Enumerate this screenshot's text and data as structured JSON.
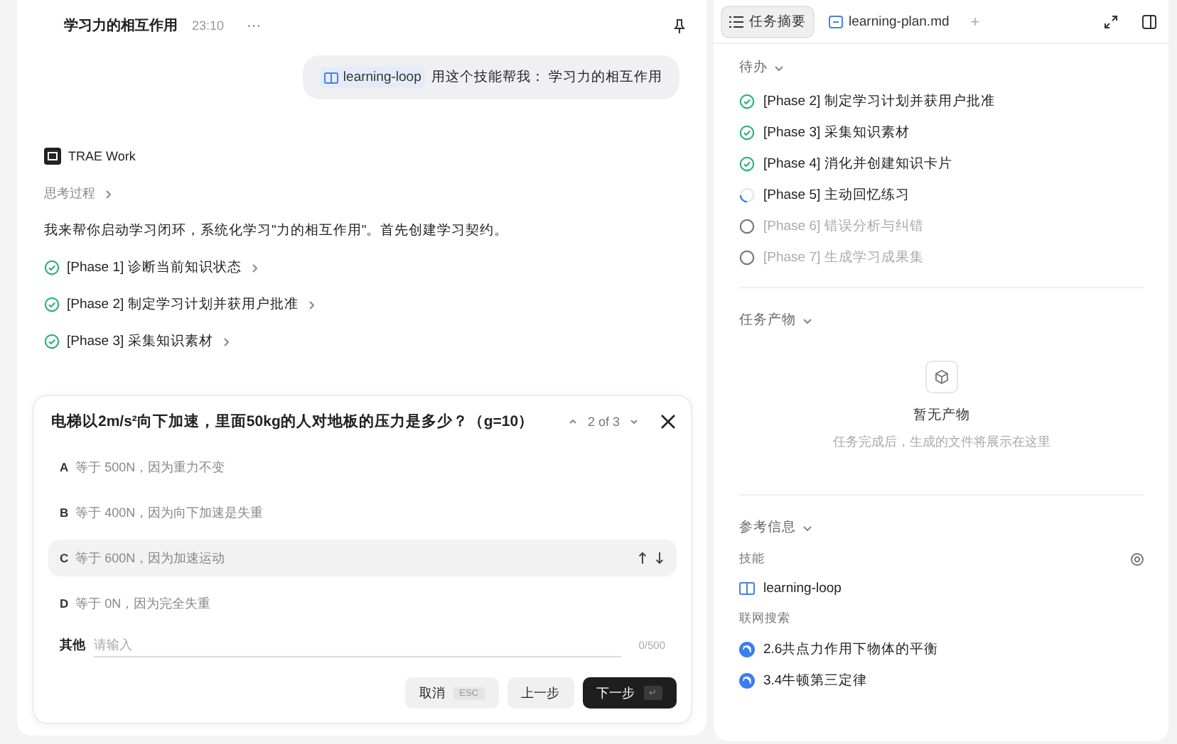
{
  "conversation": {
    "title": "学习力的相互作用",
    "time": "23:10",
    "more": "···"
  },
  "user_message": {
    "skill_tag": "learning-loop",
    "text": "用这个技能帮我： 学习力的相互作用"
  },
  "assistant": {
    "name": "TRAE Work",
    "thinking_label": "思考过程",
    "message": "我来帮你启动学习闭环，系统化学习\"力的相互作用\"。首先创建学习契约。",
    "steps": [
      {
        "label": "[Phase 1] 诊断当前知识状态",
        "completed": true
      },
      {
        "label": "[Phase 2] 制定学习计划并获用户批准",
        "completed": true
      },
      {
        "label": "[Phase 3] 采集知识素材",
        "completed": true
      }
    ]
  },
  "question": {
    "text": "电梯以2m/s²向下加速，里面50kg的人对地板的压力是多少？（g=10）",
    "pager": "2 of 3",
    "options": [
      {
        "letter": "A",
        "text": "等于 500N，因为重力不变",
        "selected": false
      },
      {
        "letter": "B",
        "text": "等于 400N，因为向下加速是失重",
        "selected": false
      },
      {
        "letter": "C",
        "text": "等于 600N，因为加速运动",
        "selected": true
      },
      {
        "letter": "D",
        "text": "等于 0N，因为完全失重",
        "selected": false
      }
    ],
    "other": {
      "label": "其他",
      "placeholder": "请输入",
      "counter": "0/500"
    },
    "buttons": [
      {
        "label": "取消",
        "shortcut": "ESC",
        "kind": "secondary"
      },
      {
        "label": "上一步",
        "kind": "secondary"
      },
      {
        "label": "下一步",
        "shortcut": "↵",
        "kind": "primary"
      }
    ]
  },
  "tabs": [
    {
      "label": "任务摘要",
      "selected": true,
      "kind": "summary"
    },
    {
      "label": "learning-plan.md",
      "selected": false,
      "kind": "file"
    }
  ],
  "add_tab": "+",
  "todo": {
    "title": "待办",
    "items": [
      {
        "label": "[Phase 2] 制定学习计划并获用户批准",
        "completed": true,
        "in_progress": false
      },
      {
        "label": "[Phase 3] 采集知识素材",
        "completed": true,
        "in_progress": false
      },
      {
        "label": "[Phase 4] 消化并创建知识卡片",
        "completed": true,
        "in_progress": false
      },
      {
        "label": "[Phase 5] 主动回忆练习",
        "completed": false,
        "in_progress": true
      },
      {
        "label": "[Phase 6] 错误分析与纠错",
        "completed": false,
        "in_progress": false
      },
      {
        "label": "[Phase 7] 生成学习成果集",
        "completed": false,
        "in_progress": false
      }
    ]
  },
  "artifacts": {
    "title": "任务产物",
    "empty_title": "暂无产物",
    "empty_text": "任务完成后，生成的文件将展示在这里"
  },
  "references": {
    "title": "参考信息",
    "skills_label": "技能",
    "skills": [
      "learning-loop"
    ],
    "web_label": "联网搜索",
    "web_results": [
      "2.6共点力作用下物体的平衡",
      "3.4牛顿第三定律"
    ]
  }
}
